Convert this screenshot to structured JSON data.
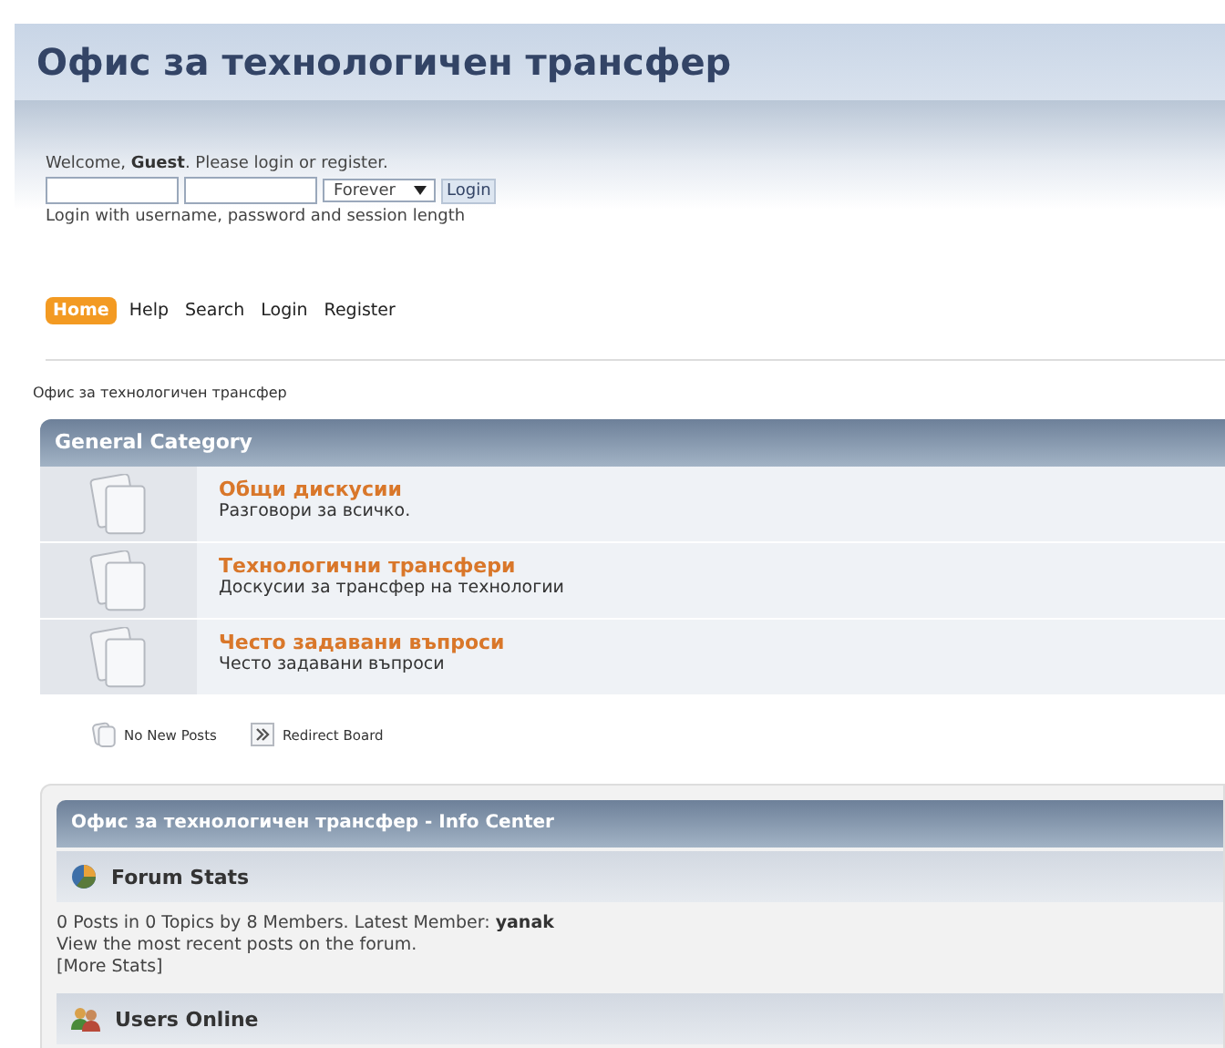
{
  "site_title": "Офис за технологичен трансфер",
  "login": {
    "welcome": "Welcome, **Guest**. Please login or register.",
    "session": "Forever",
    "button": "Login",
    "hint": "Login with username, password and session length"
  },
  "nav": [
    {
      "label": "Home",
      "selected": true
    },
    {
      "label": "Help",
      "selected": false
    },
    {
      "label": "Search",
      "selected": false
    },
    {
      "label": "Login",
      "selected": false
    },
    {
      "label": "Register",
      "selected": false
    }
  ],
  "breadcrumb": "Офис за технологичен трансфер",
  "category": {
    "title": "General Category",
    "boards": [
      {
        "name": "Общи дискусии",
        "description": "Разговори за всичко."
      },
      {
        "name": "Технологични трансфери",
        "description": "Доскусии за трансфер на технологии"
      },
      {
        "name": "Често задавани въпроси",
        "description": "Често задавани въпроси"
      }
    ]
  },
  "legend": [
    {
      "kind": "no-new",
      "label": "No New Posts"
    },
    {
      "kind": "redirect",
      "label": "Redirect Board"
    }
  ],
  "info_center": {
    "title": "Офис за технологичен трансфер - Info Center",
    "sections": [
      {
        "kind": "stats",
        "title": "Forum Stats",
        "lines": [
          "0 Posts in 0 Topics by 8 Members. Latest Member: **yanak**",
          "View the most recent posts on the forum.",
          "[More Stats]"
        ]
      },
      {
        "kind": "users",
        "title": "Users Online"
      }
    ]
  }
}
